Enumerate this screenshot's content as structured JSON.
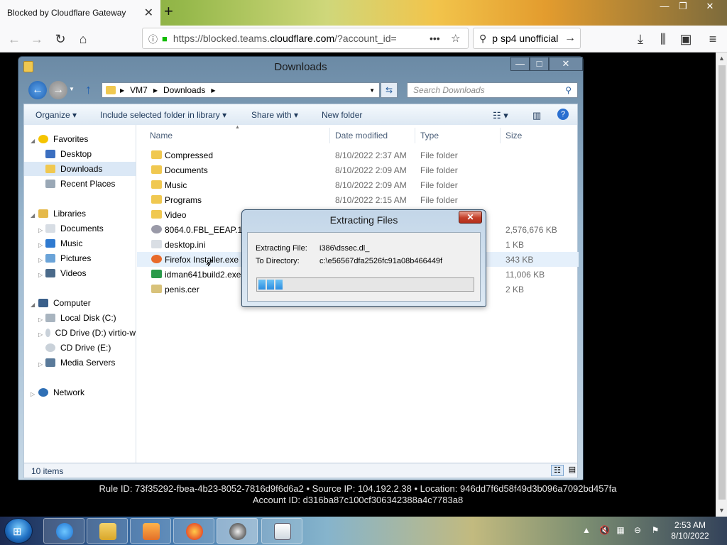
{
  "browser": {
    "tab_title": "Blocked by Cloudflare Gateway",
    "url_prefix": "https://blocked.teams.",
    "url_domain": "cloudflare.com",
    "url_suffix": "/?account_id=",
    "search_text": "p sp4 unofficial"
  },
  "explorer": {
    "title": "Downloads",
    "breadcrumb": [
      "VM7",
      "Downloads"
    ],
    "search_placeholder": "Search Downloads",
    "commands": {
      "organize": "Organize",
      "include": "Include selected folder in library",
      "share": "Share with",
      "new_folder": "New folder"
    },
    "nav": {
      "favorites": "Favorites",
      "desktop": "Desktop",
      "downloads": "Downloads",
      "recent": "Recent Places",
      "libraries": "Libraries",
      "documents": "Documents",
      "music": "Music",
      "pictures": "Pictures",
      "videos": "Videos",
      "computer": "Computer",
      "local_disk": "Local Disk (C:)",
      "cd_d": "CD Drive (D:) virtio-w",
      "cd_e": "CD Drive (E:)",
      "media_servers": "Media Servers",
      "network": "Network"
    },
    "columns": {
      "name": "Name",
      "date": "Date modified",
      "type": "Type",
      "size": "Size"
    },
    "files": [
      {
        "name": "Compressed",
        "date": "8/10/2022 2:37 AM",
        "type": "File folder",
        "size": ""
      },
      {
        "name": "Documents",
        "date": "8/10/2022 2:09 AM",
        "type": "File folder",
        "size": ""
      },
      {
        "name": "Music",
        "date": "8/10/2022 2:09 AM",
        "type": "File folder",
        "size": ""
      },
      {
        "name": "Programs",
        "date": "8/10/2022 2:15 AM",
        "type": "File folder",
        "size": ""
      },
      {
        "name": "Video",
        "date": "",
        "type": "",
        "size": ""
      },
      {
        "name": "8064.0.FBL_EEAP.110",
        "date": "",
        "type": "",
        "size": "2,576,676 KB"
      },
      {
        "name": "desktop.ini",
        "date": "",
        "type": "",
        "size": "1 KB"
      },
      {
        "name": "Firefox Installer.exe",
        "date": "",
        "type": "",
        "size": "343 KB"
      },
      {
        "name": "idman641build2.exe",
        "date": "",
        "type": "",
        "size": "11,006 KB"
      },
      {
        "name": "penis.cer",
        "date": "",
        "type": "",
        "size": "2 KB"
      }
    ],
    "status": "10 items"
  },
  "dialog": {
    "title": "Extracting Files",
    "file_label": "Extracting File:",
    "file_value": "i386\\dssec.dl_",
    "dir_label": "To Directory:",
    "dir_value": "c:\\e56567dfa2526fc91a08b466449f",
    "progress_chunks": 3
  },
  "cloudflare": {
    "line1": "Rule ID: 73f35292-fbea-4b23-8052-7816d9f6d6a2 • Source IP: 104.192.2.38 • Location: 946dd7f6d58f49d3b096a7092bd457fa",
    "line2": "Account ID: d316ba87c100cf306342388a4c7783a8"
  },
  "taskbar": {
    "time": "2:53 AM",
    "date": "8/10/2022"
  },
  "colors": {
    "accent": "#2b8de0",
    "selection": "#dbe8f6",
    "close_red": "#c4402b"
  },
  "icons": {
    "back": "arrow-left-icon",
    "forward": "arrow-right-icon",
    "reload": "reload-icon",
    "home": "home-icon",
    "lock": "lock-icon",
    "star": "star-icon",
    "download": "download-icon",
    "library": "library-icon",
    "sidebar": "sidebar-icon",
    "menu": "hamburger-icon",
    "folder": "folder-icon"
  }
}
